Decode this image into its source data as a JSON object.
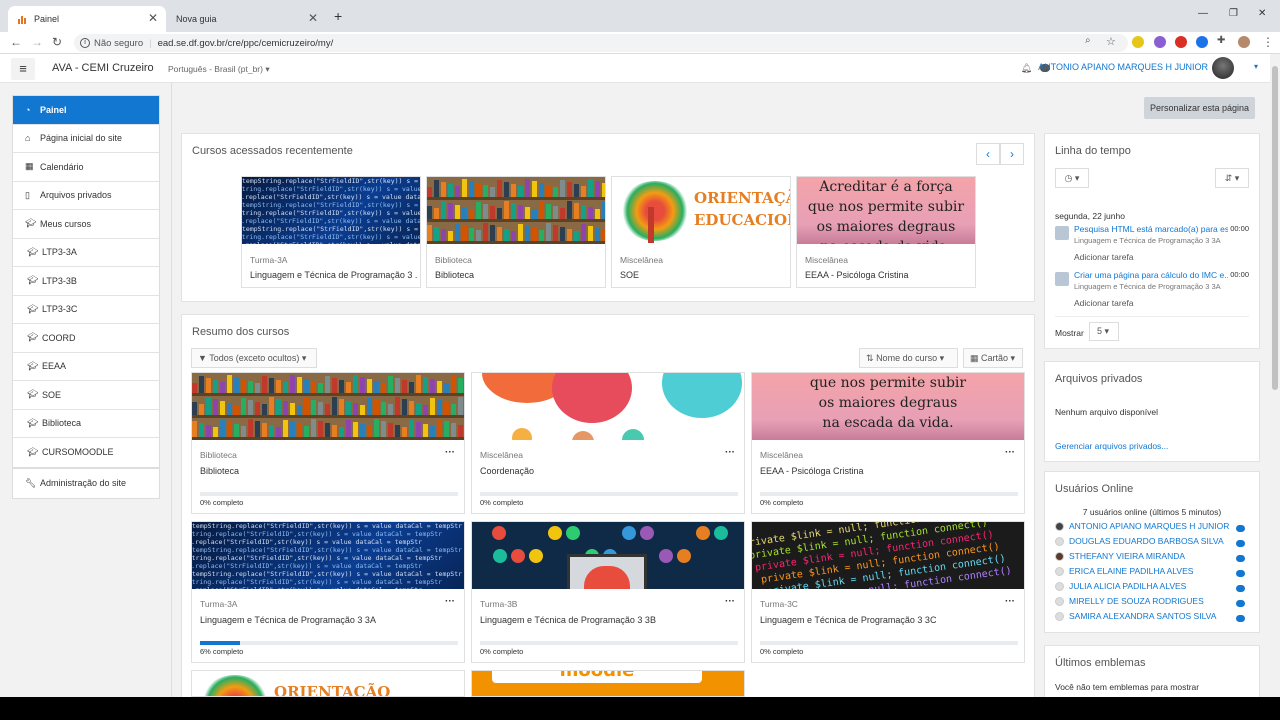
{
  "browser": {
    "tabs": [
      {
        "title": "Painel",
        "active": true
      },
      {
        "title": "Nova guia",
        "active": false
      }
    ],
    "not_secure": "Não seguro",
    "url": "ead.se.df.gov.br/cre/ppc/cemicruzeiro/my/"
  },
  "navbar": {
    "site_name": "AVA - CEMI Cruzeiro",
    "language": "Português - Brasil (pt_br)",
    "user_name": "ANTONIO APIANO MARQUES H JUNIOR"
  },
  "drawer": {
    "main": [
      {
        "label": "Painel",
        "icon": "dashboard-icon",
        "active": true
      },
      {
        "label": "Página inicial do site",
        "icon": "home-icon"
      },
      {
        "label": "Calendário",
        "icon": "calendar-icon"
      },
      {
        "label": "Arquivos privados",
        "icon": "file-icon"
      },
      {
        "label": "Meus cursos",
        "icon": "graduation-cap-icon"
      },
      {
        "label": "LTP3-3A",
        "icon": "graduation-cap-icon"
      },
      {
        "label": "LTP3-3B",
        "icon": "graduation-cap-icon"
      },
      {
        "label": "LTP3-3C",
        "icon": "graduation-cap-icon"
      },
      {
        "label": "COORD",
        "icon": "graduation-cap-icon"
      },
      {
        "label": "EEAA",
        "icon": "graduation-cap-icon"
      },
      {
        "label": "SOE",
        "icon": "graduation-cap-icon"
      },
      {
        "label": "Biblioteca",
        "icon": "graduation-cap-icon"
      },
      {
        "label": "CURSOMOODLE",
        "icon": "graduation-cap-icon"
      }
    ],
    "admin": {
      "label": "Administração do site",
      "icon": "wrench-icon"
    }
  },
  "page": {
    "customize_button": "Personalizar esta página"
  },
  "recent": {
    "title": "Cursos acessados recentemente",
    "courses": [
      {
        "category": "Turma-3A",
        "name": "Linguagem e Técnica de Programação 3 ...",
        "image": "code"
      },
      {
        "category": "Biblioteca",
        "name": "Biblioteca",
        "image": "books"
      },
      {
        "category": "Miscelânea",
        "name": "SOE",
        "image": "orientacao"
      },
      {
        "category": "Miscelânea",
        "name": "EEAA - Psicóloga Cristina",
        "image": "quote"
      }
    ]
  },
  "overview": {
    "title": "Resumo dos cursos",
    "filter": "Todos (exceto ocultos)",
    "sort": "Nome do curso",
    "view": "Cartão",
    "courses": [
      {
        "category": "Biblioteca",
        "name": "Biblioteca",
        "progress": "0% completo",
        "progress_value": 0,
        "image": "books"
      },
      {
        "category": "Miscelânea",
        "name": "Coordenação",
        "progress": "0% completo",
        "progress_value": 0,
        "image": "bubbles"
      },
      {
        "category": "Miscelânea",
        "name": "EEAA - Psicóloga Cristina",
        "progress": "0% completo",
        "progress_value": 0,
        "image": "quote2"
      },
      {
        "category": "Turma-3A",
        "name": "Linguagem e Técnica de Programação 3 3A",
        "progress": "6% completo",
        "progress_value": 6,
        "image": "code"
      },
      {
        "category": "Turma-3B",
        "name": "Linguagem e Técnica de Programação 3 3B",
        "progress": "0% completo",
        "progress_value": 0,
        "image": "dev"
      },
      {
        "category": "Turma-3C",
        "name": "Linguagem e Técnica de Programação 3 3C",
        "progress": "0% completo",
        "progress_value": 0,
        "image": "code2"
      }
    ],
    "partial_images": [
      "orientacao",
      "moodle"
    ]
  },
  "image_text": {
    "quote_1": "Acreditar é a força",
    "quote_2": "que nos permite subir",
    "quote_3": "os maiores degraus",
    "quote_4": "na escada da vida.",
    "orient_1": "ORIENTAÇÃO",
    "orient_2": "EDUCACIONAL",
    "moodle": "moodle"
  },
  "timeline": {
    "title": "Linha do tempo",
    "date": "segunda, 22 junho",
    "events": [
      {
        "title": "Pesquisa HTML está marcado(a) para es...",
        "course": "Linguagem e Técnica de Programação 3 3A",
        "time": "00:00",
        "action": "Adicionar tarefa"
      },
      {
        "title": "Criar uma página para cálculo do IMC e...",
        "course": "Linguagem e Técnica de Programação 3 3A",
        "time": "00:00",
        "action": "Adicionar tarefa"
      }
    ],
    "show_label": "Mostrar",
    "show_value": "5"
  },
  "private_files": {
    "title": "Arquivos privados",
    "empty": "Nenhum arquivo disponível",
    "manage_link": "Gerenciar arquivos privados..."
  },
  "online_users": {
    "title": "Usuários Online",
    "summary": "7 usuários online (últimos 5 minutos)",
    "users": [
      "ANTONIO APIANO MARQUES H JUNIOR",
      "DOUGLAS EDUARDO BARBOSA SILVA",
      "STHEFANY VIEIRA MIRANDA",
      "ERICA ELAINE PADILHA ALVES",
      "JULIA ALICIA PADILHA ALVES",
      "MIRELLY DE SOUZA RODRIGUES",
      "SAMIRA ALEXANDRA SANTOS SILVA"
    ]
  },
  "badges": {
    "title": "Últimos emblemas",
    "empty": "Você não tem emblemas para mostrar"
  },
  "colors": {
    "accent": "#1177d1",
    "active_nav": "#1177d1",
    "page_bg": "#f2f2f2"
  }
}
